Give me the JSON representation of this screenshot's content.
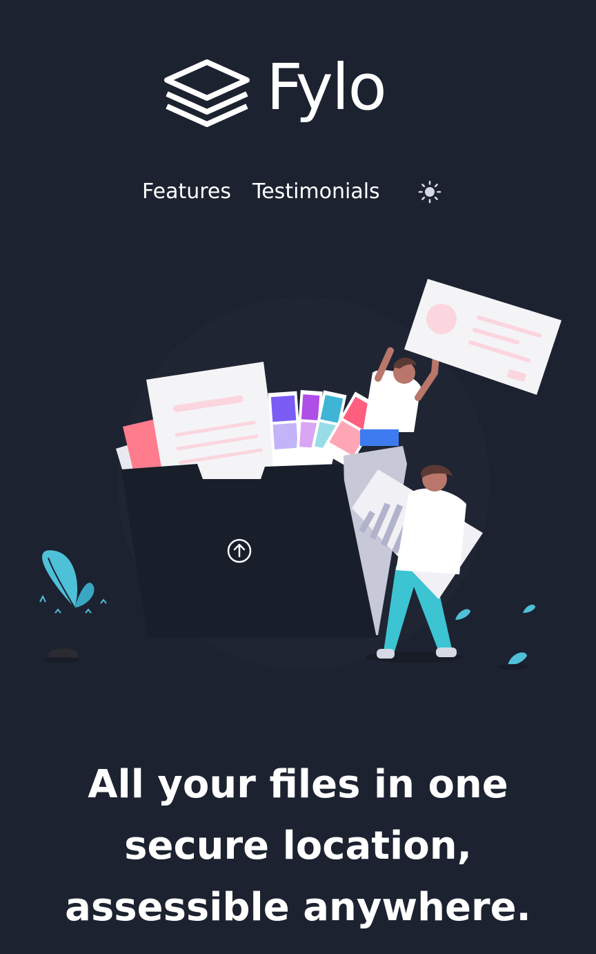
{
  "brand": {
    "logo_icon": "stacked-layers-icon",
    "name": "Fylo"
  },
  "nav": {
    "features_label": "Features",
    "testimonials_label": "Testimonials",
    "theme_toggle_icon": "sun-icon"
  },
  "hero": {
    "illustration": "hero-illustration",
    "upload_icon": "upload-arrow-icon",
    "headline": "All your files in one secure location, assessible anywhere."
  },
  "colors": {
    "background": "#1c2230",
    "folder": "#181e2a",
    "text": "#ffffff",
    "accent_cyan": "#4ec0d8",
    "accent_pink": "#ff7c8c"
  }
}
